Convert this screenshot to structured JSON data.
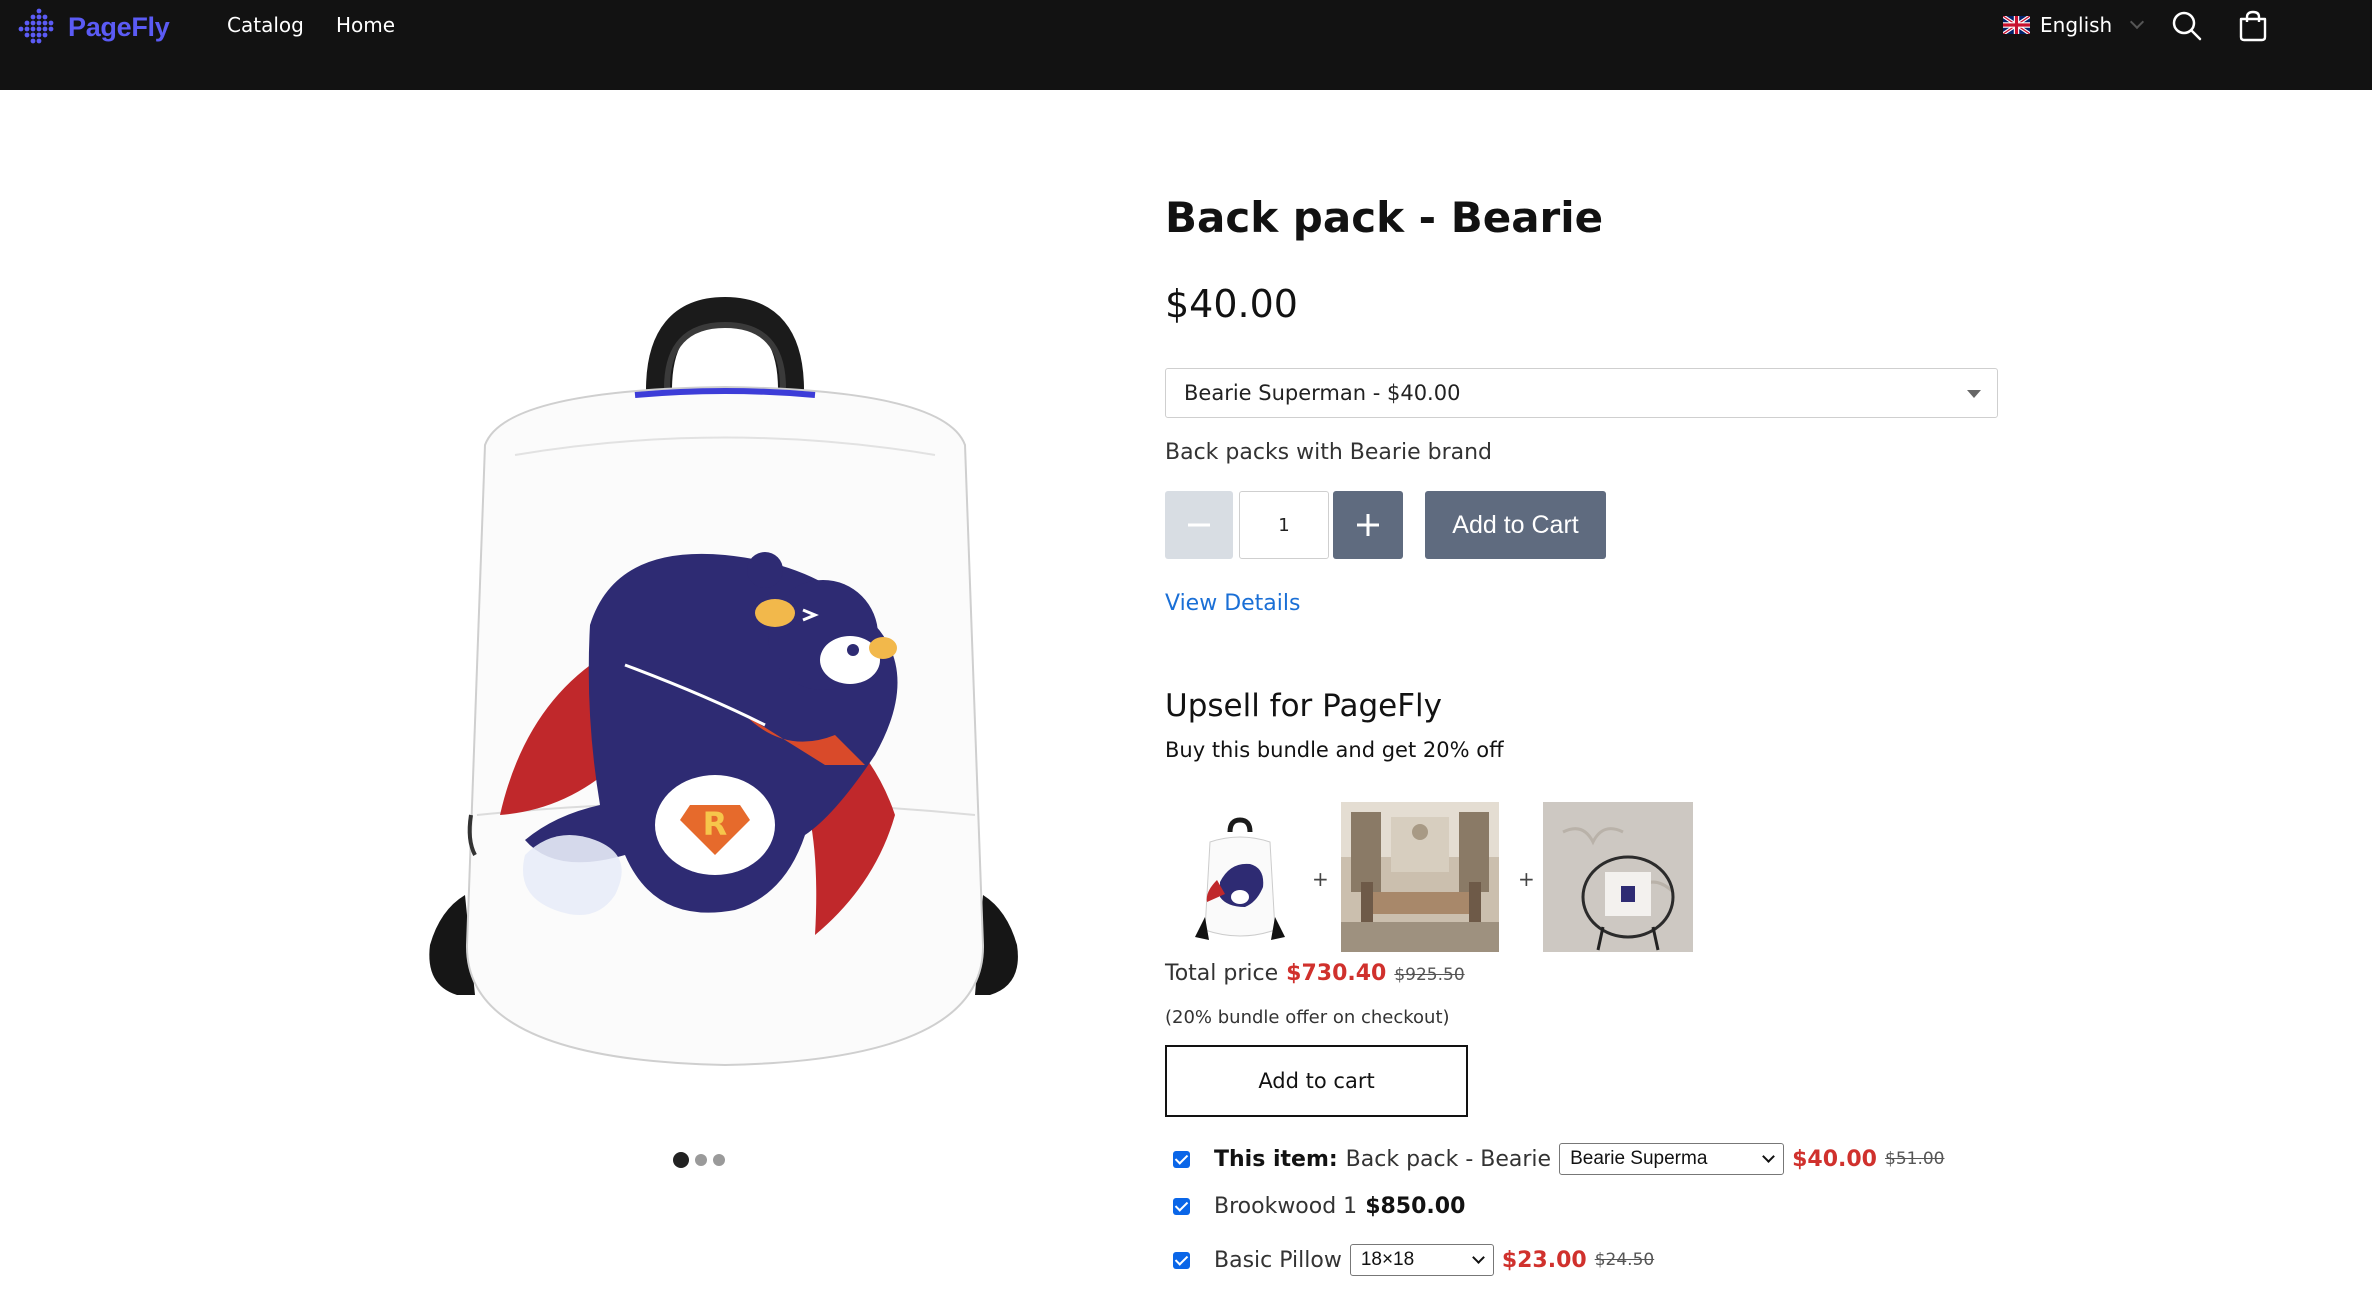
{
  "header": {
    "logo_text": "PageFly",
    "nav": [
      "Catalog",
      "Home"
    ],
    "language": "English"
  },
  "product": {
    "title": "Back pack - Bearie",
    "price": "$40.00",
    "variant_selected": "Bearie Superman - $40.00",
    "description": "Back packs with Bearie brand",
    "quantity": "1",
    "add_to_cart_label": "Add to Cart",
    "view_details_label": "View Details",
    "gallery": {
      "slides": 3,
      "active_index": 0
    }
  },
  "upsell": {
    "title": "Upsell for PageFly",
    "subtitle": "Buy this bundle and get 20% off",
    "plus_symbol": "+",
    "total_label": "Total price",
    "total_price": "$730.40",
    "total_compare": "$925.50",
    "note": "(20% bundle offer on checkout)",
    "button_label": "Add to cart",
    "items": [
      {
        "prefix": "This item:",
        "name": "Back pack - Bearie",
        "option": "Bearie Superma",
        "price": "$40.00",
        "compare": "$51.00",
        "checked": true
      },
      {
        "name": "Brookwood 1",
        "price": "$850.00",
        "checked": true
      },
      {
        "name": "Basic Pillow",
        "option": "18×18",
        "price": "$23.00",
        "compare": "$24.50",
        "checked": true
      }
    ]
  },
  "colors": {
    "header_bg": "#121212",
    "brand": "#5b5bf5",
    "button": "#5f6b7f",
    "sale_red": "#d0312d",
    "link": "#1a6fd6",
    "checkbox": "#0a66e8"
  }
}
